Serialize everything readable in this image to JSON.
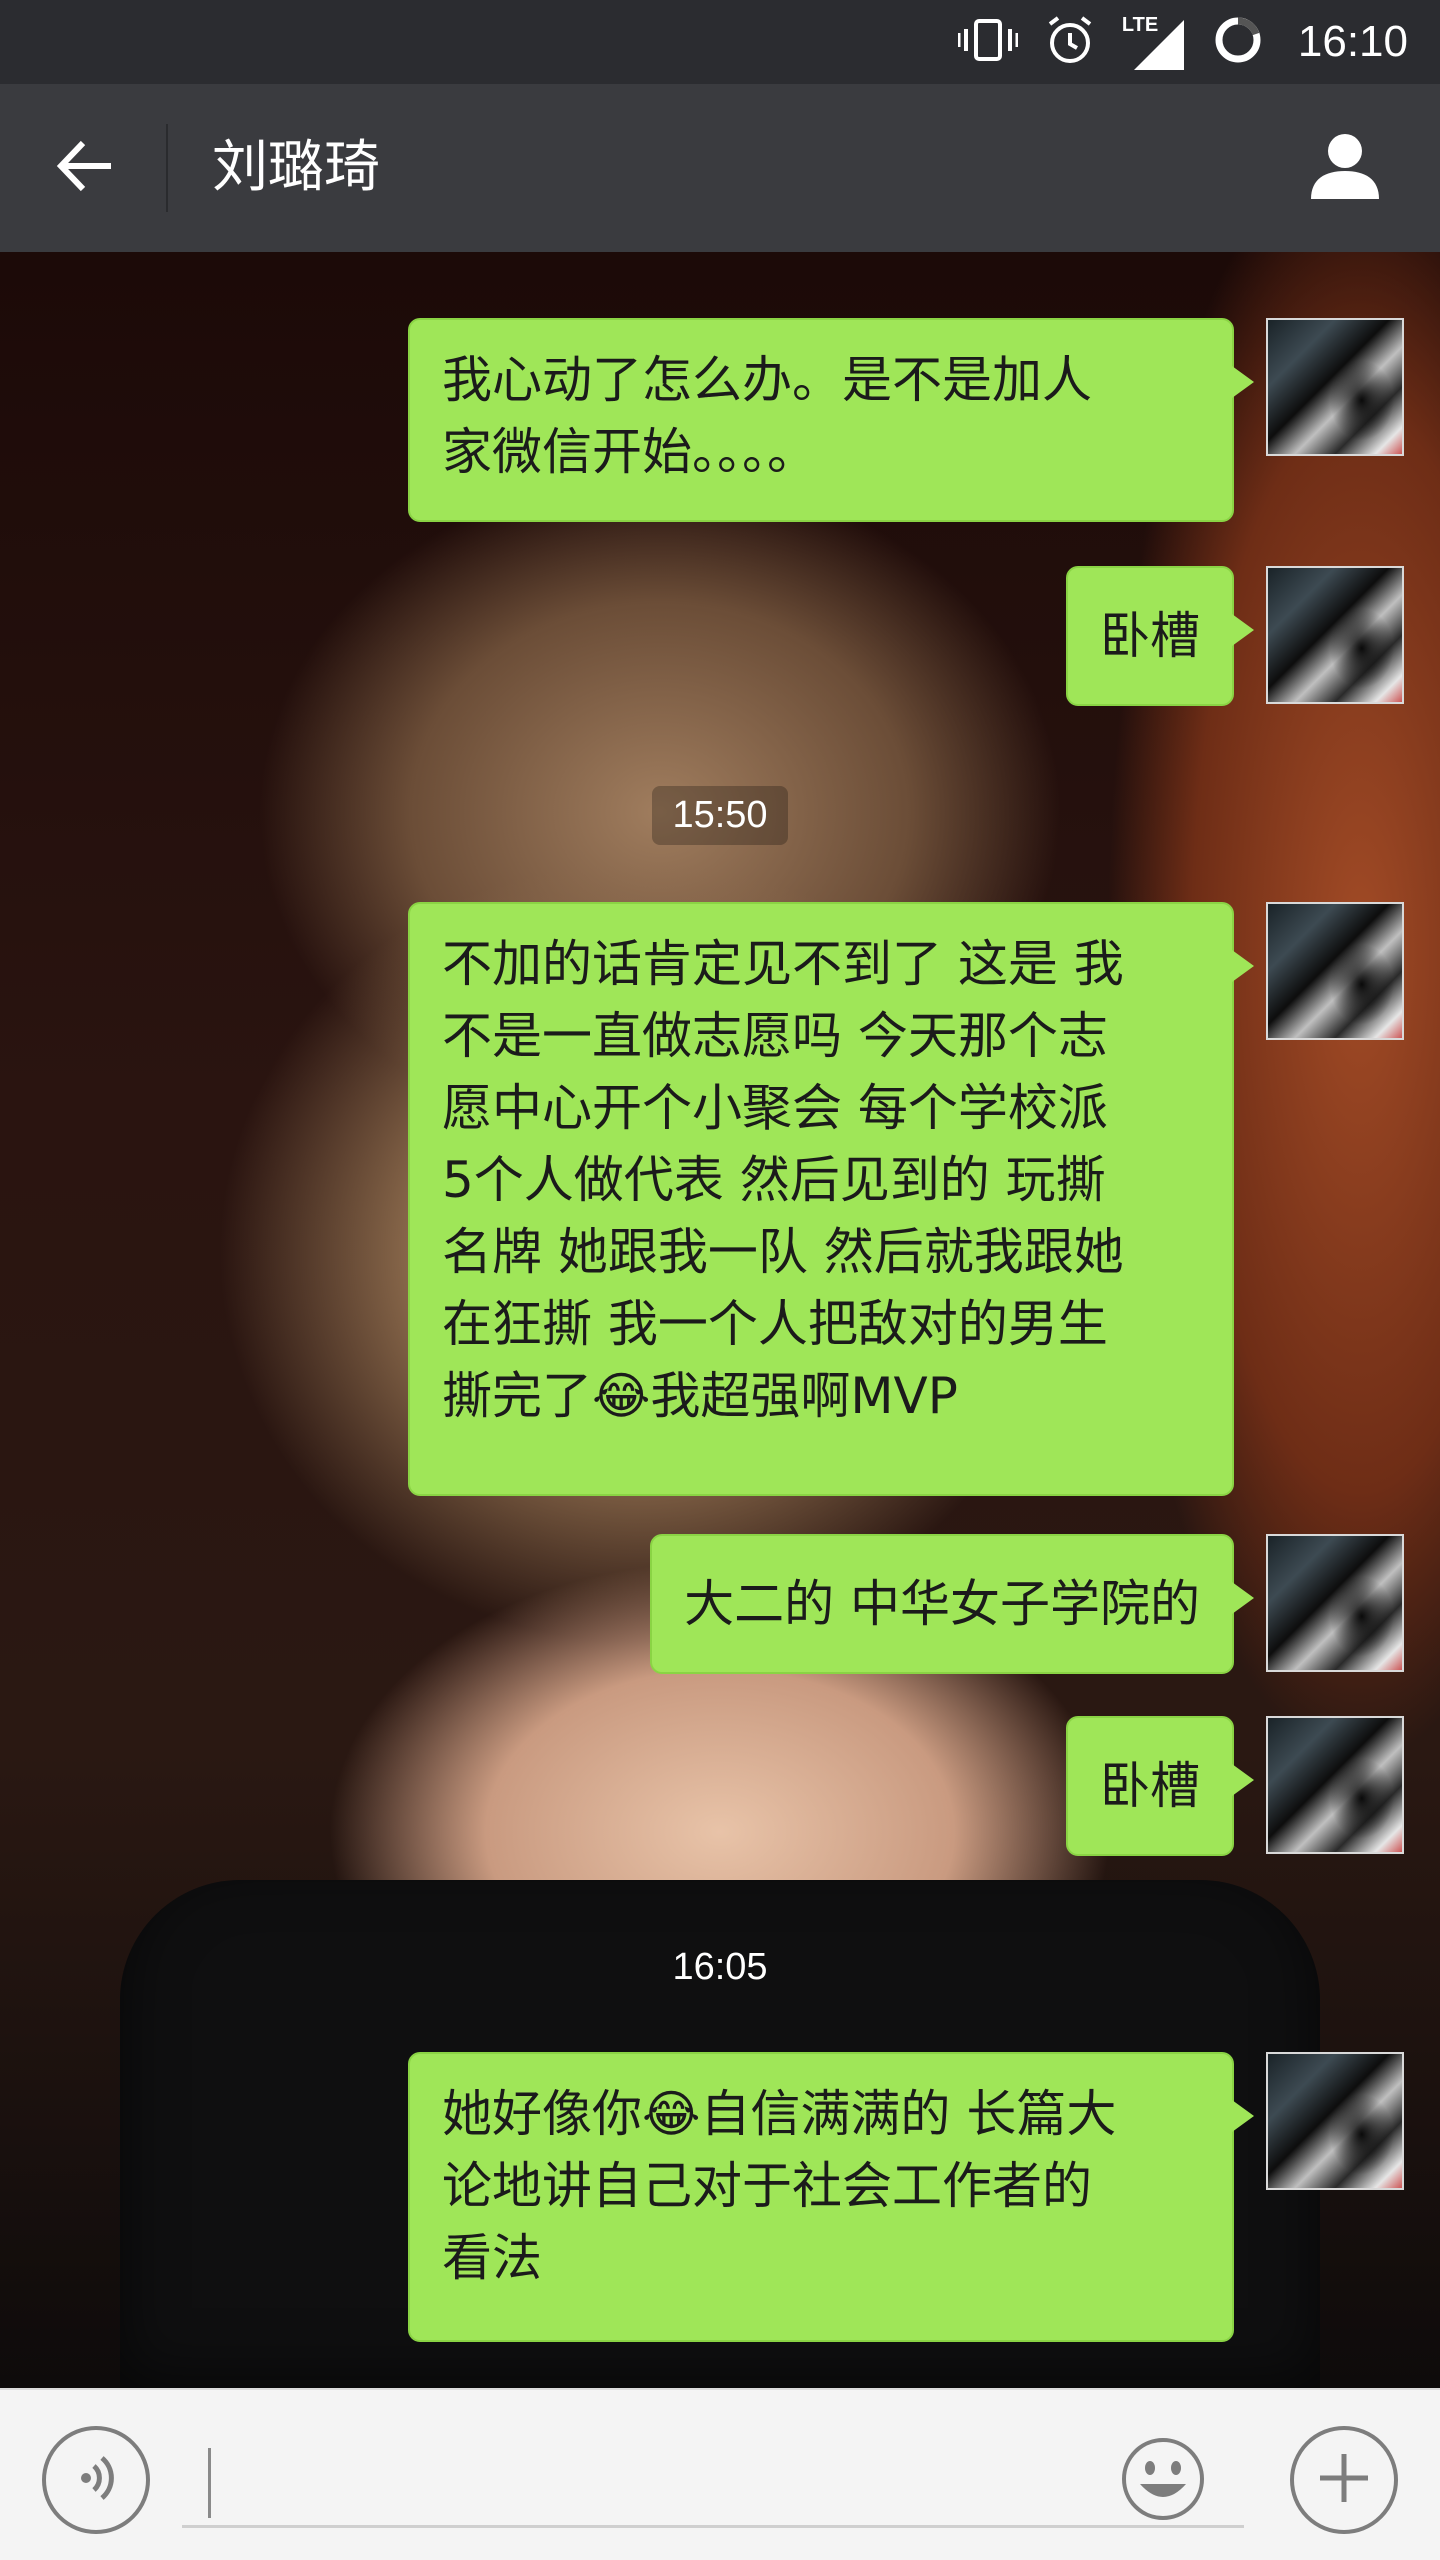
{
  "status_bar": {
    "time": "16:10",
    "network_label": "LTE",
    "icons": [
      "vibrate-icon",
      "alarm-icon",
      "signal-icon",
      "loading-icon"
    ]
  },
  "header": {
    "title": "刘璐琦",
    "back_icon": "arrow-left-icon",
    "profile_icon": "person-icon"
  },
  "chat": {
    "timestamps": [
      "15:50",
      "16:05"
    ],
    "messages": [
      {
        "text": "我心动了怎么办。是不是加人\n家微信开始。。。。",
        "sender": "me"
      },
      {
        "text": "卧槽",
        "sender": "me"
      },
      {
        "text": "不加的话肯定见不到了 这是 我\n不是一直做志愿吗 今天那个志\n愿中心开个小聚会 每个学校派\n5个人做代表 然后见到的 玩撕\n名牌 她跟我一队 然后就我跟她\n在狂撕 我一个人把敌对的男生\n撕完了😂我超强啊MVP",
        "sender": "me"
      },
      {
        "text": "大二的 中华女子学院的",
        "sender": "me"
      },
      {
        "text": "卧槽",
        "sender": "me"
      },
      {
        "text": "她好像你😂自信满满的 长篇大\n论地讲自己对于社会工作者的\n看法",
        "sender": "me"
      }
    ]
  },
  "input_bar": {
    "text_value": "",
    "voice_icon": "voice-icon",
    "emoji_icon": "smiley-icon",
    "plus_icon": "plus-icon"
  },
  "colors": {
    "status_bar": "#2b2c30",
    "title_bar": "#3a3b3f",
    "bubble": "#9fe658",
    "input_bar": "#f4f4f4"
  }
}
